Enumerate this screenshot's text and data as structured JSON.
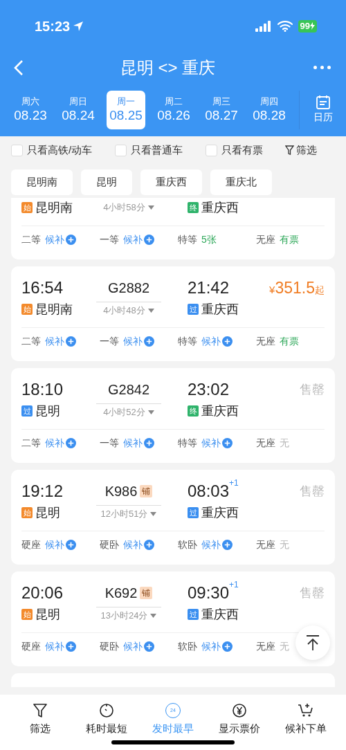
{
  "status_bar": {
    "time": "15:23",
    "battery": "99"
  },
  "header": {
    "title": "昆明 <> 重庆"
  },
  "dates": [
    {
      "weekday": "周六",
      "date": "08.23",
      "selected": false
    },
    {
      "weekday": "周日",
      "date": "08.24",
      "selected": false
    },
    {
      "weekday": "周一",
      "date": "08.25",
      "selected": true
    },
    {
      "weekday": "周二",
      "date": "08.26",
      "selected": false
    },
    {
      "weekday": "周三",
      "date": "08.27",
      "selected": false
    },
    {
      "weekday": "周四",
      "date": "08.28",
      "selected": false
    }
  ],
  "calendar": {
    "label": "日历"
  },
  "filters": [
    {
      "label": "只看高铁/动车",
      "checked": false
    },
    {
      "label": "只看普通车",
      "checked": false
    },
    {
      "label": "只看有票",
      "checked": false
    }
  ],
  "filter_button": {
    "label": "筛选"
  },
  "stations": [
    {
      "label": "昆明南"
    },
    {
      "label": "昆明"
    },
    {
      "label": "重庆西"
    },
    {
      "label": "重庆北"
    }
  ],
  "trains": [
    {
      "from": {
        "badge": "始",
        "kind": "start",
        "name": "昆明南"
      },
      "duration": "4小时58分",
      "to": {
        "badge": "终",
        "kind": "end",
        "name": "重庆西"
      },
      "seats": [
        {
          "class": "二等",
          "status": "候补",
          "kind": "waitlist"
        },
        {
          "class": "一等",
          "status": "候补",
          "kind": "waitlist"
        },
        {
          "class": "特等",
          "status": "5张",
          "kind": "available"
        },
        {
          "class": "无座",
          "status": "有票",
          "kind": "available"
        }
      ]
    },
    {
      "depart": "16:54",
      "number": "G2882",
      "arrive": "21:42",
      "price": {
        "kind": "price",
        "currency": "¥",
        "amount": "351.5",
        "suffix": "起"
      },
      "from": {
        "badge": "始",
        "kind": "start",
        "name": "昆明南"
      },
      "duration": "4小时48分",
      "to": {
        "badge": "过",
        "kind": "pass",
        "name": "重庆西"
      },
      "seats": [
        {
          "class": "二等",
          "status": "候补",
          "kind": "waitlist"
        },
        {
          "class": "一等",
          "status": "候补",
          "kind": "waitlist"
        },
        {
          "class": "特等",
          "status": "候补",
          "kind": "waitlist"
        },
        {
          "class": "无座",
          "status": "有票",
          "kind": "available"
        }
      ]
    },
    {
      "depart": "18:10",
      "number": "G2842",
      "arrive": "23:02",
      "price": {
        "kind": "soldout",
        "text": "售罄"
      },
      "from": {
        "badge": "过",
        "kind": "pass",
        "name": "昆明"
      },
      "duration": "4小时52分",
      "to": {
        "badge": "终",
        "kind": "end",
        "name": "重庆西"
      },
      "seats": [
        {
          "class": "二等",
          "status": "候补",
          "kind": "waitlist"
        },
        {
          "class": "一等",
          "status": "候补",
          "kind": "waitlist"
        },
        {
          "class": "特等",
          "status": "候补",
          "kind": "waitlist"
        },
        {
          "class": "无座",
          "status": "无",
          "kind": "none"
        }
      ]
    },
    {
      "depart": "19:12",
      "number": "K986",
      "tag": "铺",
      "arrive": "08:03",
      "next_day": "+1",
      "price": {
        "kind": "soldout",
        "text": "售罄"
      },
      "from": {
        "badge": "始",
        "kind": "start",
        "name": "昆明"
      },
      "duration": "12小时51分",
      "to": {
        "badge": "过",
        "kind": "pass",
        "name": "重庆西"
      },
      "seats": [
        {
          "class": "硬座",
          "status": "候补",
          "kind": "waitlist"
        },
        {
          "class": "硬卧",
          "status": "候补",
          "kind": "waitlist"
        },
        {
          "class": "软卧",
          "status": "候补",
          "kind": "waitlist"
        },
        {
          "class": "无座",
          "status": "无",
          "kind": "none"
        }
      ]
    },
    {
      "depart": "20:06",
      "number": "K692",
      "tag": "铺",
      "arrive": "09:30",
      "next_day": "+1",
      "price": {
        "kind": "soldout",
        "text": "售罄"
      },
      "from": {
        "badge": "始",
        "kind": "start",
        "name": "昆明"
      },
      "duration": "13小时24分",
      "to": {
        "badge": "过",
        "kind": "pass",
        "name": "重庆西"
      },
      "seats": [
        {
          "class": "硬座",
          "status": "候补",
          "kind": "waitlist"
        },
        {
          "class": "硬卧",
          "status": "候补",
          "kind": "waitlist"
        },
        {
          "class": "软卧",
          "status": "候补",
          "kind": "waitlist"
        },
        {
          "class": "无座",
          "status": "无",
          "kind": "none"
        }
      ]
    }
  ],
  "bottom_nav": [
    {
      "label": "筛选",
      "kind": "filter",
      "selected": false
    },
    {
      "label": "耗时最短",
      "kind": "timer",
      "selected": false
    },
    {
      "label": "发时最早",
      "kind": "clock24",
      "icon_text": "24",
      "selected": true
    },
    {
      "label": "显示票价",
      "kind": "yen",
      "selected": false
    },
    {
      "label": "候补下单",
      "kind": "cart",
      "selected": false
    }
  ]
}
